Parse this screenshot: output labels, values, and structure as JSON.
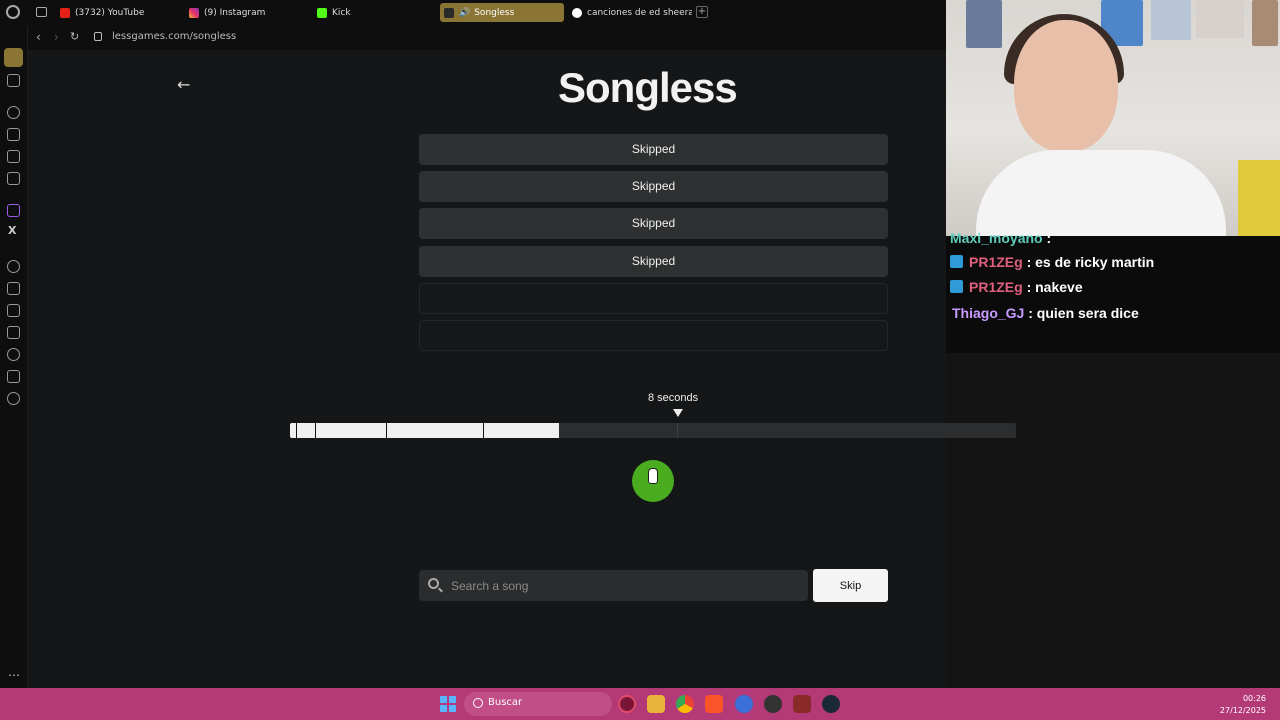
{
  "browser": {
    "tabs": [
      {
        "label": "(3732) YouTube",
        "active": false
      },
      {
        "label": "(9) Instagram",
        "active": false
      },
      {
        "label": "Kick",
        "active": false
      },
      {
        "label": "Songless",
        "active": true
      },
      {
        "label": "canciones de ed sheeran",
        "active": false
      }
    ],
    "url": "lessgames.com/songless",
    "accent": "#8a7535"
  },
  "game": {
    "title": "Songless",
    "guesses": [
      {
        "label": "Skipped"
      },
      {
        "label": "Skipped"
      },
      {
        "label": "Skipped"
      },
      {
        "label": "Skipped"
      },
      {
        "label": ""
      },
      {
        "label": ""
      }
    ],
    "current_duration_label": "8 seconds",
    "played_fraction": 0.37,
    "search": {
      "placeholder": "Search a song",
      "value": ""
    },
    "skip_label": "Skip",
    "play_color": "#4aad1f"
  },
  "chat": {
    "messages": [
      {
        "user": "Maxi_moyano",
        "text": ":"
      },
      {
        "user": "PR1ZEg",
        "text": ": es de ricky martin"
      },
      {
        "user": "PR1ZEg",
        "text": ": nakeve"
      },
      {
        "user": "Thiago_GJ",
        "text": ": quien sera dice"
      }
    ]
  },
  "taskbar": {
    "search_label": "Buscar",
    "time": "00:26",
    "date": "27/12/2025"
  }
}
